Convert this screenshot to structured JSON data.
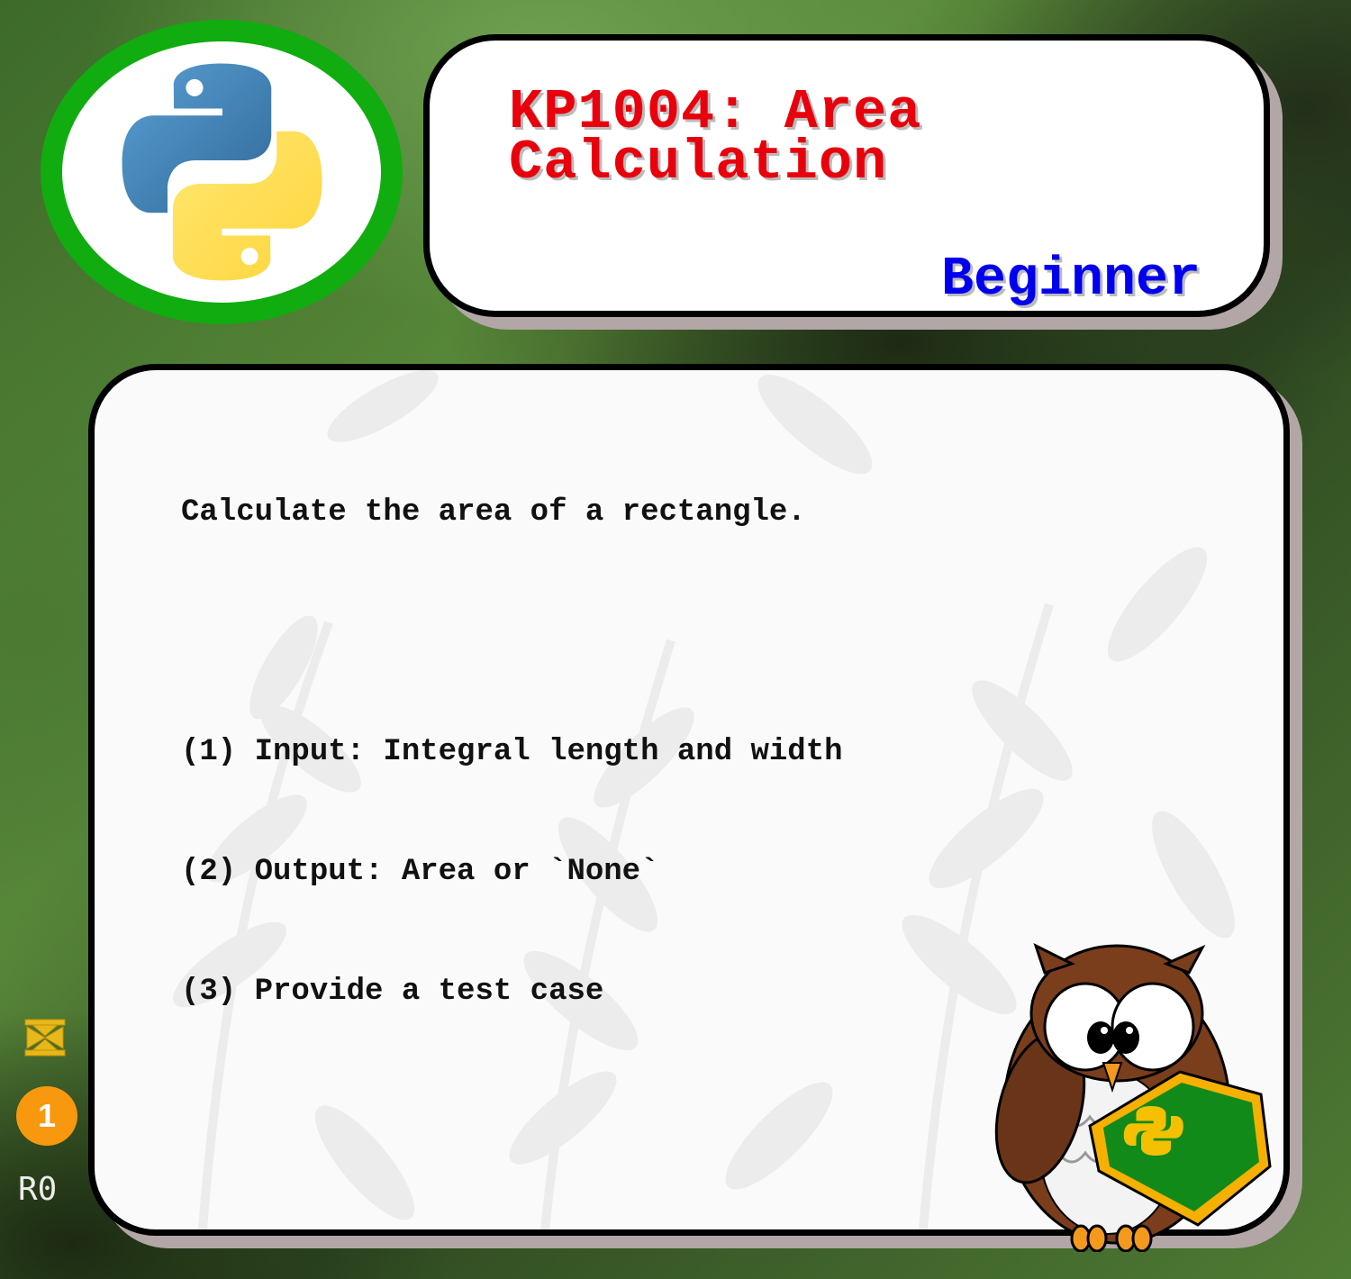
{
  "header": {
    "title_line1": "KP1004: Area",
    "title_line2": "Calculation",
    "level": "Beginner"
  },
  "logo": {
    "icon": "python-logo-icon",
    "ring_color": "#10ac10"
  },
  "description": {
    "intro": "Calculate the area of a rectangle.",
    "items": [
      "(1) Input: Integral length and width",
      "(2) Output: Area or `None`",
      "(3) Provide a test case"
    ]
  },
  "sidebar": {
    "ornament_icon": "ornament-icon",
    "badge_count": "1",
    "revision": "R0"
  },
  "colors": {
    "title": "#e8000c",
    "level": "#0000ee",
    "badge": "#f7980e",
    "shield": "#118a1a"
  }
}
